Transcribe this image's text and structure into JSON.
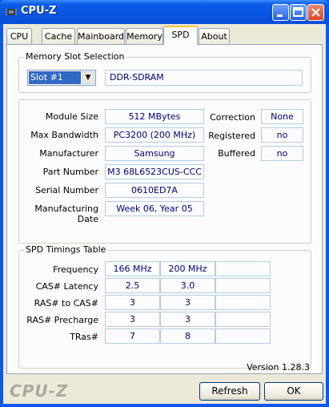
{
  "window": {
    "title": "CPU-Z"
  },
  "tabs": [
    "CPU",
    "Cache",
    "Mainboard",
    "Memory",
    "SPD",
    "About"
  ],
  "slot_selection": {
    "group_title": "Memory Slot Selection",
    "selected_slot": "Slot #1",
    "memory_type": "DDR-SDRAM"
  },
  "module_info": {
    "module_size_label": "Module Size",
    "module_size": "512 MBytes",
    "max_bandwidth_label": "Max Bandwidth",
    "max_bandwidth": "PC3200 (200 MHz)",
    "manufacturer_label": "Manufacturer",
    "manufacturer": "Samsung",
    "part_number_label": "Part Number",
    "part_number": "M3 68L6523CUS-CCC",
    "serial_number_label": "Serial Number",
    "serial_number": "0610ED7A",
    "mfg_date_label": "Manufacturing Date",
    "mfg_date": "Week 06, Year 05",
    "correction_label": "Correction",
    "correction": "None",
    "registered_label": "Registered",
    "registered": "no",
    "buffered_label": "Buffered",
    "buffered": "no"
  },
  "timings": {
    "group_title": "SPD Timings Table",
    "rows": [
      {
        "label": "Frequency",
        "v1": "166 MHz",
        "v2": "200 MHz"
      },
      {
        "label": "CAS# Latency",
        "v1": "2.5",
        "v2": "3.0"
      },
      {
        "label": "RAS# to CAS#",
        "v1": "3",
        "v2": "3"
      },
      {
        "label": "RAS# Precharge",
        "v1": "3",
        "v2": "3"
      },
      {
        "label": "TRas#",
        "v1": "7",
        "v2": "8"
      }
    ]
  },
  "footer": {
    "version": "Version 1.28.3",
    "brand": "CPU-Z",
    "refresh_label": "Refresh",
    "ok_label": "OK"
  }
}
